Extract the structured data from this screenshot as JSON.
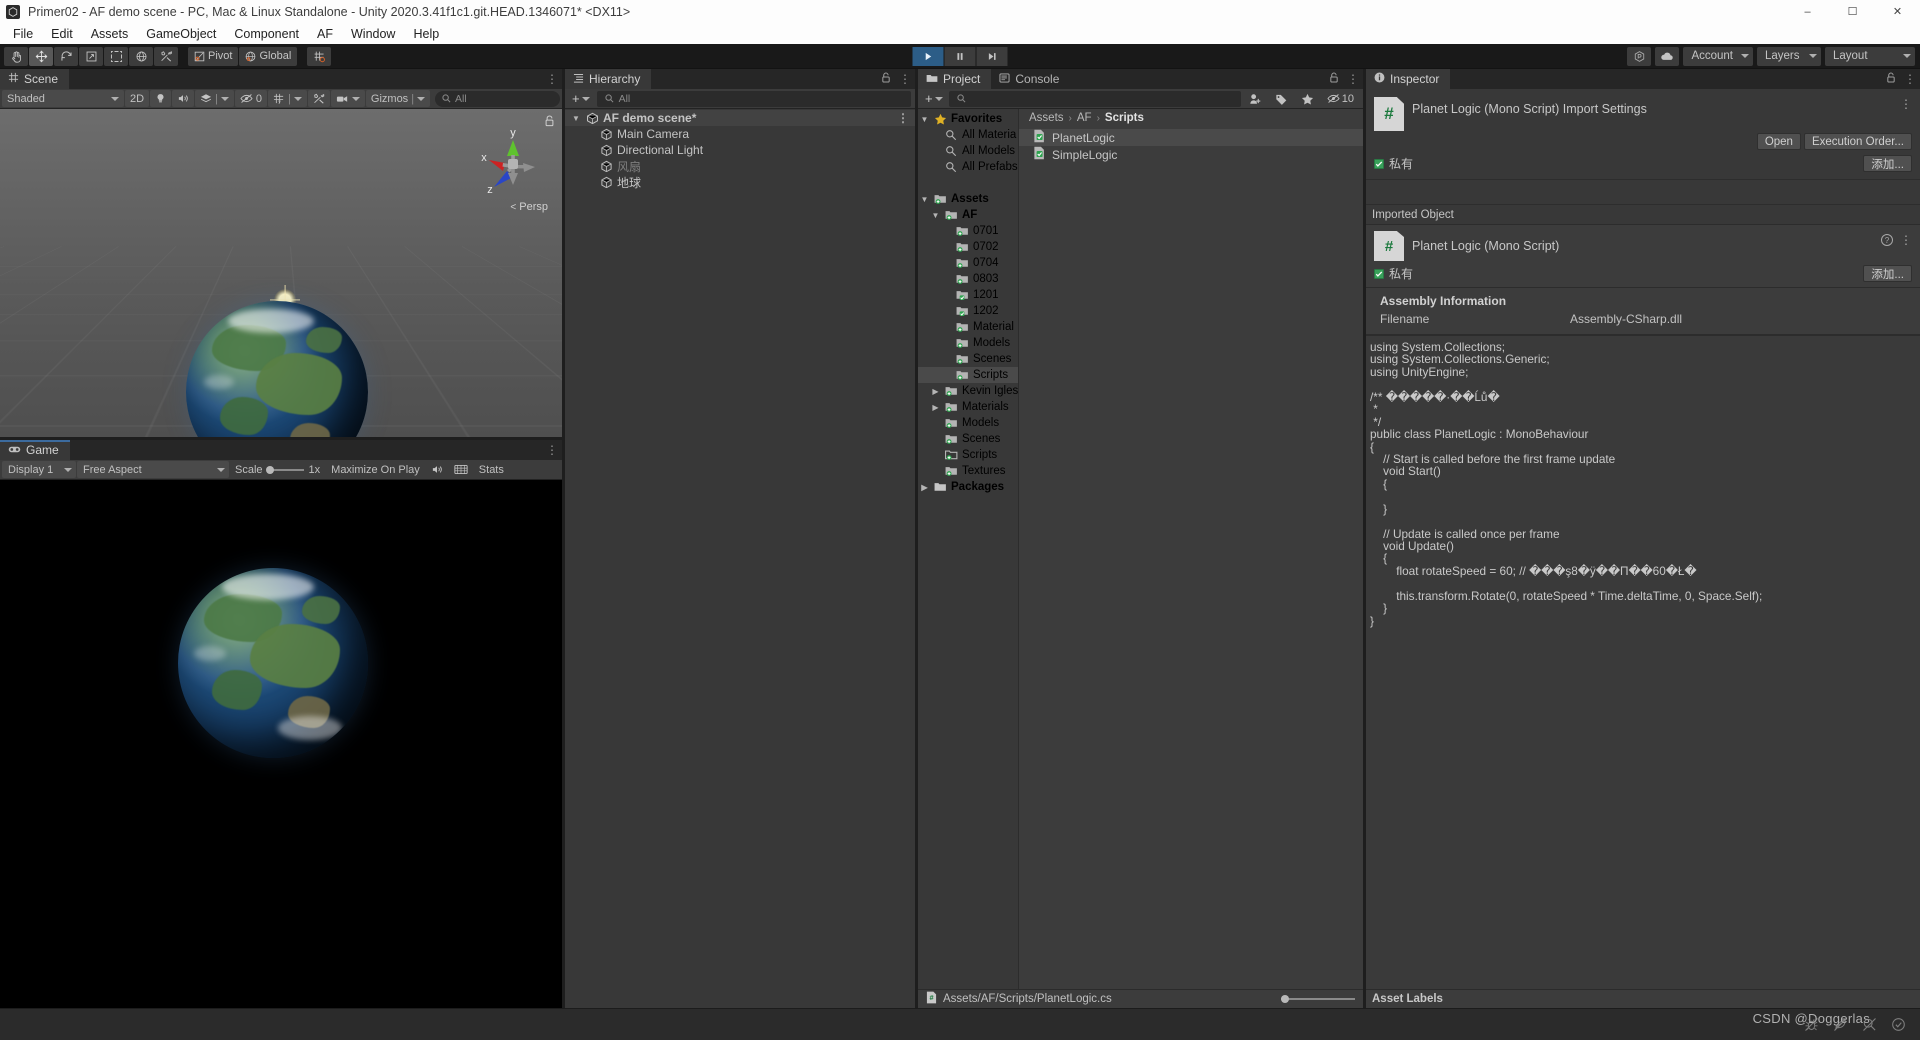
{
  "window": {
    "title": "Primer02 - AF demo scene - PC, Mac & Linux Standalone - Unity 2020.3.41f1c1.git.HEAD.1346071* <DX11>",
    "minimize": "–",
    "maximize": "☐",
    "close": "✕"
  },
  "menu": [
    "File",
    "Edit",
    "Assets",
    "GameObject",
    "Component",
    "AF",
    "Window",
    "Help"
  ],
  "toolbar": {
    "tools": [
      {
        "name": "hand-tool",
        "icon": "hand",
        "active": false
      },
      {
        "name": "move-tool",
        "icon": "move",
        "active": true
      },
      {
        "name": "rotate-tool",
        "icon": "rotate",
        "active": false
      },
      {
        "name": "scale-tool",
        "icon": "scale",
        "active": false
      },
      {
        "name": "rect-tool",
        "icon": "rect",
        "active": false
      },
      {
        "name": "transform-tool",
        "icon": "transform",
        "active": false
      },
      {
        "name": "custom-tool",
        "icon": "wrench",
        "active": false
      }
    ],
    "pivot_label": "Pivot",
    "global_label": "Global",
    "snap_label": "",
    "play_label": "▶",
    "pause_label": "‖",
    "step_label": "▶|",
    "play_active": true,
    "collab_label": "",
    "cloud_label": "",
    "account_label": "Account",
    "layers_label": "Layers",
    "layout_label": "Layout"
  },
  "scene": {
    "tab_label": "Scene",
    "shading_mode": "Shaded",
    "twod_label": "2D",
    "lighting_label": "",
    "audio_label": "",
    "fx_label": "",
    "hidden_count": "0",
    "grid_label": "",
    "gizmos_label": "Gizmos",
    "search_placeholder": "All",
    "persp_label": "Persp",
    "axis_x": "x",
    "axis_y": "y",
    "axis_z": "z"
  },
  "game": {
    "tab_label": "Game",
    "display": "Display 1",
    "aspect": "Free Aspect",
    "scale_label": "Scale",
    "scale_value": "1x",
    "maximize_label": "Maximize On Play",
    "mute_label": "",
    "stats_label": "Stats"
  },
  "hierarchy": {
    "tab_label": "Hierarchy",
    "create_label": "+",
    "search_placeholder": "All",
    "items": [
      {
        "label": "AF demo scene*",
        "indent": 0,
        "icon": "scene-icon",
        "expanded": true,
        "root": true,
        "dim": false
      },
      {
        "label": "Main Camera",
        "indent": 1,
        "icon": "gameobject-icon",
        "expanded": null,
        "root": false,
        "dim": false
      },
      {
        "label": "Directional Light",
        "indent": 1,
        "icon": "gameobject-icon",
        "expanded": null,
        "root": false,
        "dim": false
      },
      {
        "label": "风扇",
        "indent": 1,
        "icon": "gameobject-icon",
        "expanded": null,
        "root": false,
        "dim": true
      },
      {
        "label": "地球",
        "indent": 1,
        "icon": "gameobject-icon",
        "expanded": null,
        "root": false,
        "dim": false
      }
    ]
  },
  "project": {
    "tab_label": "Project",
    "console_tab_label": "Console",
    "create_label": "+",
    "search_placeholder": "",
    "hidden_count": "10",
    "breadcrumb": [
      "Assets",
      "AF",
      "Scripts"
    ],
    "tree": [
      {
        "label": "Favorites",
        "indent": 0,
        "icon": "star-icon",
        "expanded": true,
        "bold": true,
        "selected": false
      },
      {
        "label": "All Materia",
        "indent": 1,
        "icon": "search-icon",
        "expanded": null,
        "bold": false,
        "selected": false
      },
      {
        "label": "All Models",
        "indent": 1,
        "icon": "search-icon",
        "expanded": null,
        "bold": false,
        "selected": false
      },
      {
        "label": "All Prefabs",
        "indent": 1,
        "icon": "search-icon",
        "expanded": null,
        "bold": false,
        "selected": false
      },
      {
        "label": "",
        "indent": 0,
        "icon": "none",
        "expanded": null,
        "bold": false,
        "selected": false
      },
      {
        "label": "Assets",
        "indent": 0,
        "icon": "folder-add-icon",
        "expanded": true,
        "bold": true,
        "selected": false
      },
      {
        "label": "AF",
        "indent": 1,
        "icon": "folder-add-icon",
        "expanded": true,
        "bold": true,
        "selected": false
      },
      {
        "label": "0701",
        "indent": 2,
        "icon": "folder-add-icon",
        "expanded": null,
        "bold": false,
        "selected": false
      },
      {
        "label": "0702",
        "indent": 2,
        "icon": "folder-add-icon",
        "expanded": null,
        "bold": false,
        "selected": false
      },
      {
        "label": "0704",
        "indent": 2,
        "icon": "folder-add-icon",
        "expanded": null,
        "bold": false,
        "selected": false
      },
      {
        "label": "0803",
        "indent": 2,
        "icon": "folder-add-icon",
        "expanded": null,
        "bold": false,
        "selected": false
      },
      {
        "label": "1201",
        "indent": 2,
        "icon": "folder-check-icon",
        "expanded": null,
        "bold": false,
        "selected": false
      },
      {
        "label": "1202",
        "indent": 2,
        "icon": "folder-check-icon",
        "expanded": null,
        "bold": false,
        "selected": false
      },
      {
        "label": "Material",
        "indent": 2,
        "icon": "folder-add-icon",
        "expanded": null,
        "bold": false,
        "selected": false
      },
      {
        "label": "Models",
        "indent": 2,
        "icon": "folder-add-icon",
        "expanded": null,
        "bold": false,
        "selected": false
      },
      {
        "label": "Scenes",
        "indent": 2,
        "icon": "folder-add-icon",
        "expanded": null,
        "bold": false,
        "selected": false
      },
      {
        "label": "Scripts",
        "indent": 2,
        "icon": "folder-add-icon",
        "expanded": null,
        "bold": false,
        "selected": true
      },
      {
        "label": "Kevin Igles",
        "indent": 1,
        "icon": "folder-add-icon",
        "expanded": false,
        "bold": false,
        "selected": false
      },
      {
        "label": "Materials",
        "indent": 1,
        "icon": "folder-add-icon",
        "expanded": false,
        "bold": false,
        "selected": false
      },
      {
        "label": "Models",
        "indent": 1,
        "icon": "folder-add-icon",
        "expanded": null,
        "bold": false,
        "selected": false
      },
      {
        "label": "Scenes",
        "indent": 1,
        "icon": "folder-add-icon",
        "expanded": null,
        "bold": false,
        "selected": false
      },
      {
        "label": "Scripts",
        "indent": 1,
        "icon": "folder-open-icon",
        "expanded": null,
        "bold": false,
        "selected": false
      },
      {
        "label": "Textures",
        "indent": 1,
        "icon": "folder-add-icon",
        "expanded": null,
        "bold": false,
        "selected": false
      },
      {
        "label": "Packages",
        "indent": 0,
        "icon": "folder-icon",
        "expanded": false,
        "bold": true,
        "selected": false
      }
    ],
    "assets": [
      {
        "label": "PlanetLogic",
        "icon": "cs-script-icon",
        "selected": true
      },
      {
        "label": "SimpleLogic",
        "icon": "cs-script-icon",
        "selected": false
      }
    ],
    "footer_path": "Assets/AF/Scripts/PlanetLogic.cs"
  },
  "inspector": {
    "tab_label": "Inspector",
    "import_title": "Planet Logic (Mono Script) Import Settings",
    "open_label": "Open",
    "execution_order_label": "Execution Order...",
    "private_label": "私有",
    "add_label": "添加...",
    "imported_object_label": "Imported Object",
    "object_title": "Planet Logic (Mono Script)",
    "assembly_title": "Assembly Information",
    "filename_key": "Filename",
    "filename_value": "Assembly-CSharp.dll",
    "asset_labels": "Asset Labels",
    "code": "using System.Collections;\nusing System.Collections.Generic;\nusing UnityEngine;\n\n/** �����·��Ĺů�\n *\n */\npublic class PlanetLogic : MonoBehaviour\n{\n    // Start is called before the first frame update\n    void Start()\n    {\n\n    }\n\n    // Update is called once per frame\n    void Update()\n    {\n        float rotateSpeed = 60; // ���ş8�ÿ��П��60�Ł�\n\n        this.transform.Rotate(0, rotateSpeed * Time.deltaTime, 0, Space.Self);\n    }\n}"
  },
  "statusbar": {
    "watermark": "CSDN @Doggerlas"
  },
  "colors": {
    "accent_blue": "#2c5d87",
    "panel_bg": "#383838",
    "toolbar_bg": "#3c3c3c",
    "selection": "#4a4a4a",
    "green": "#38a15a"
  }
}
